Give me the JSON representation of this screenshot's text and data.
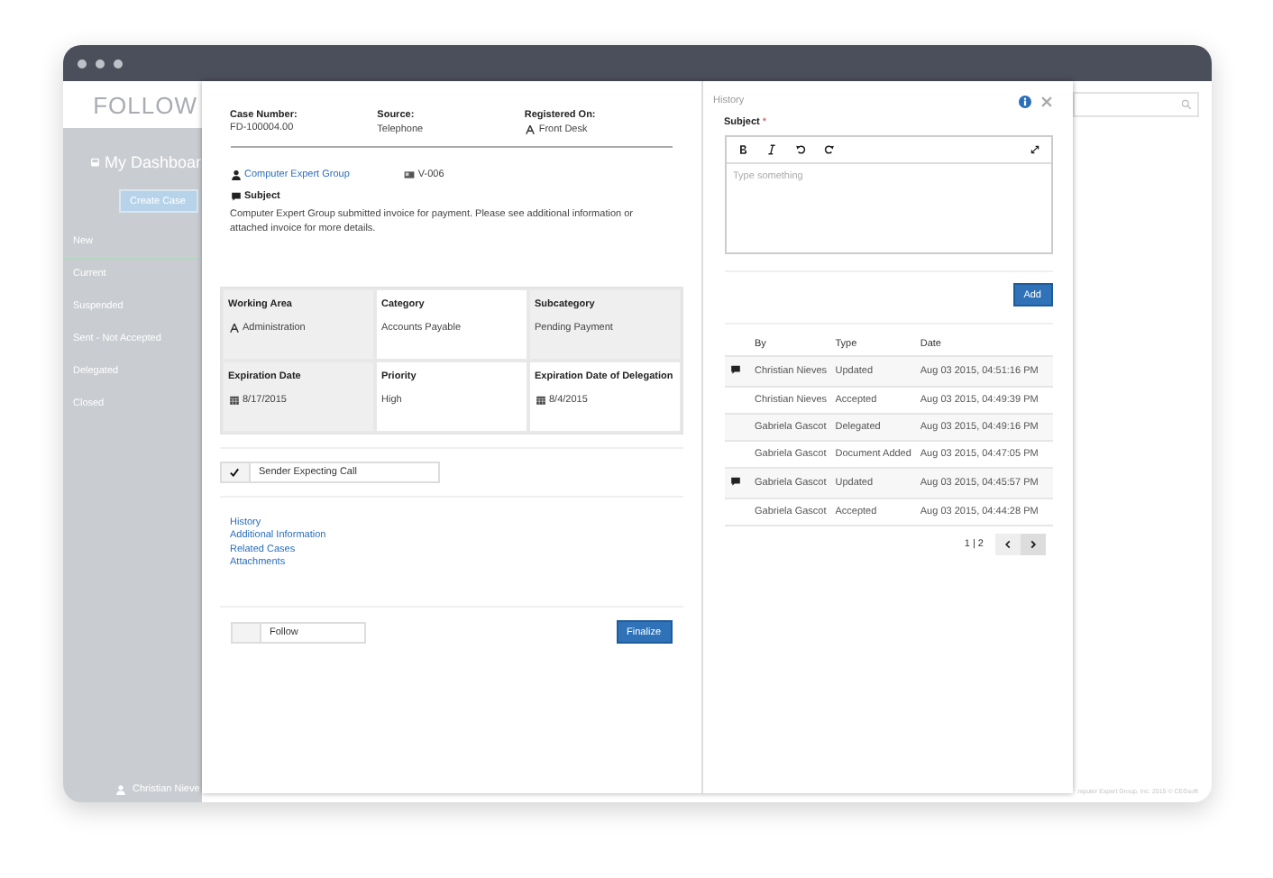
{
  "app": {
    "logo": "FOLLOW",
    "dashboard": "My Dashboar",
    "create_button": "Create Case",
    "user": "Christian Nieve",
    "footer": "mputer Expert Group, Inc. 2015 © CEGsoft"
  },
  "sidebar": {
    "items": [
      {
        "label": "New",
        "selected": true
      },
      {
        "label": "Current",
        "selected": false
      },
      {
        "label": "Suspended",
        "selected": false
      },
      {
        "label": "Sent - Not Accepted",
        "selected": false
      },
      {
        "label": "Delegated",
        "selected": false
      },
      {
        "label": "Closed",
        "selected": false
      }
    ]
  },
  "case": {
    "header": [
      {
        "label": "Case Number:",
        "value": "FD-100004.00",
        "kind": "text"
      },
      {
        "label": "Source:",
        "value": "Telephone",
        "kind": "text"
      },
      {
        "label": "Registered On:",
        "value": "Front Desk",
        "kind": "area"
      }
    ],
    "company": "Computer Expert Group",
    "code": "V-006",
    "subject_label": "Subject",
    "subject": "Computer Expert Group submitted invoice for payment. Please see additional information or attached invoice for more details.",
    "fields": [
      {
        "label": "Working Area",
        "value": "Administration",
        "kind": "area"
      },
      {
        "label": "Category",
        "value": "Accounts Payable",
        "kind": "text"
      },
      {
        "label": "Subcategory",
        "value": "Pending Payment",
        "kind": "text"
      },
      {
        "label": "Expiration Date",
        "value": "8/17/2015",
        "kind": "date"
      },
      {
        "label": "Priority",
        "value": "High",
        "kind": "text"
      },
      {
        "label": "Expiration Date of Delegation",
        "value": "8/4/2015",
        "kind": "date"
      }
    ],
    "expecting_call": {
      "label": "Sender Expecting Call",
      "checked": true
    },
    "links": [
      "History",
      "Additional Information",
      "Related Cases",
      "Attachments"
    ],
    "follow": {
      "label": "Follow",
      "checked": false
    },
    "finalize_button": "Finalize"
  },
  "history": {
    "title": "History",
    "subject_label": "Subject",
    "required_mark": "*",
    "editor": {
      "placeholder": "Type something"
    },
    "add_button": "Add",
    "table": {
      "columns": [
        "By",
        "Type",
        "Date"
      ],
      "rows": [
        {
          "by": "Christian Nieves",
          "type": "Updated",
          "date": "Aug 03 2015, 04:51:16 PM",
          "comment": true
        },
        {
          "by": "Christian Nieves",
          "type": "Accepted",
          "date": "Aug 03 2015, 04:49:39 PM",
          "comment": false
        },
        {
          "by": "Gabriela Gascot",
          "type": "Delegated",
          "date": "Aug 03 2015, 04:49:16 PM",
          "comment": false
        },
        {
          "by": "Gabriela Gascot",
          "type": "Document Added",
          "date": "Aug 03 2015, 04:47:05 PM",
          "comment": false
        },
        {
          "by": "Gabriela Gascot",
          "type": "Updated",
          "date": "Aug 03 2015, 04:45:57 PM",
          "comment": true
        },
        {
          "by": "Gabriela Gascot",
          "type": "Accepted",
          "date": "Aug 03 2015, 04:44:28 PM",
          "comment": false
        }
      ]
    },
    "pagination": "1 | 2"
  }
}
